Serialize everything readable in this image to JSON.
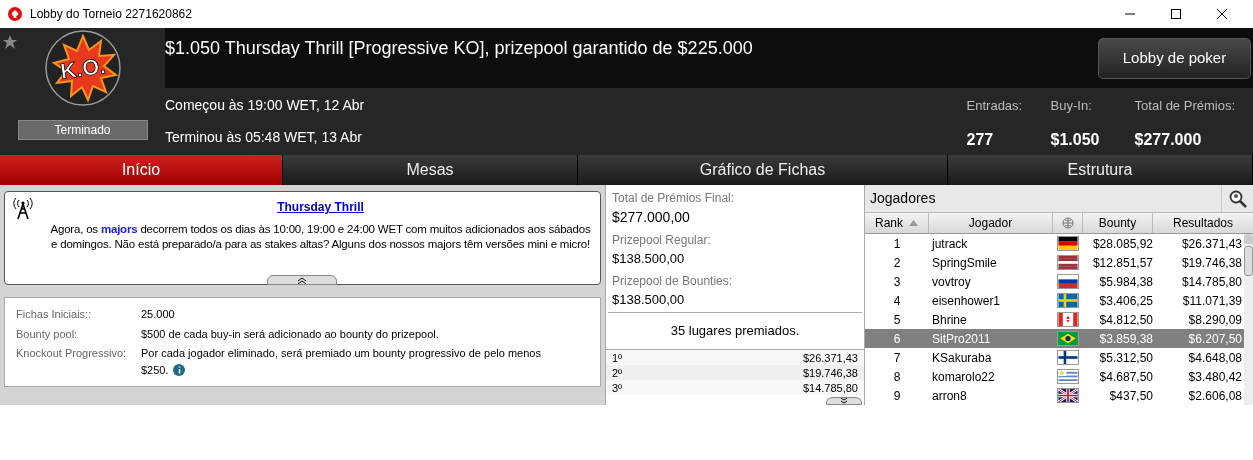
{
  "window": {
    "title": "Lobby do Torneio 2271620862"
  },
  "header": {
    "title": "$1.050 Thursday Thrill [Progressive KO], prizepool garantido de $225.000",
    "logo_text": "K.O.",
    "status": "Terminado",
    "started": "Começou às 19:00 WET, 12 Abr",
    "ended": "Terminou às 05:48 WET, 13 Abr",
    "lobby_button": "Lobby de poker",
    "stats": [
      {
        "label": "Entradas:",
        "value": "277"
      },
      {
        "label": "Buy-In:",
        "value": "$1.050"
      },
      {
        "label": "Total de Prémios:",
        "value": "$277.000"
      }
    ]
  },
  "tabs": [
    {
      "label": "Início",
      "selected": true
    },
    {
      "label": "Mesas",
      "selected": false
    },
    {
      "label": "Gráfico de Fichas",
      "selected": false
    },
    {
      "label": "Estrutura",
      "selected": false
    }
  ],
  "news": {
    "title": "Thursday Thrill",
    "text": "Agora, os **majors** decorrem todos os dias às 10:00, 19:00 e 24:00 WET com muitos adicionados aos sábados e domingos. Não está preparado/a para as stakes altas? Alguns dos nossos majors têm versões mini e micro!"
  },
  "details": [
    {
      "label": "Fichas Iniciais::",
      "value": "25.000"
    },
    {
      "label": "Bounty pool:",
      "value": "$500 de cada buy-in será adicionado ao bounty do prizepool."
    },
    {
      "label": "Knockout Progressivo:",
      "value": "Por cada jogador eliminado, será premiado um bounty progressivo de pelo menos $250."
    }
  ],
  "prizepool": [
    {
      "label": "Total de Prémios Final:",
      "value": "$277.000,00"
    },
    {
      "label": "Prizepool Regular:",
      "value": "$138.500,00"
    },
    {
      "label": "Prizepool de Bounties:",
      "value": "$138.500,00"
    }
  ],
  "paid_places": "35 lugares premiados.",
  "payouts": [
    {
      "place": "1º",
      "amount": "$26.371,43"
    },
    {
      "place": "2º",
      "amount": "$19.746,38"
    },
    {
      "place": "3º",
      "amount": "$14.785,80"
    }
  ],
  "players": {
    "title": "Jogadores",
    "columns": [
      "Rank",
      "Jogador",
      "Bounty",
      "Resultados"
    ],
    "rows": [
      {
        "rank": "1",
        "name": "jutrack",
        "bounty": "$28.085,92",
        "result": "$26.371,43",
        "selected": false
      },
      {
        "rank": "2",
        "name": "SpringSmile",
        "bounty": "$12.851,57",
        "result": "$19.746,38",
        "selected": false
      },
      {
        "rank": "3",
        "name": "vovtroy",
        "bounty": "$5.984,38",
        "result": "$14.785,80",
        "selected": false
      },
      {
        "rank": "4",
        "name": "eisenhower1",
        "bounty": "$3.406,25",
        "result": "$11.071,39",
        "selected": false
      },
      {
        "rank": "5",
        "name": "Bhrine",
        "bounty": "$4.812,50",
        "result": "$8.290,09",
        "selected": false
      },
      {
        "rank": "6",
        "name": "SitPro2011",
        "bounty": "$3.859,38",
        "result": "$6.207,50",
        "selected": true
      },
      {
        "rank": "7",
        "name": "KSakuraba",
        "bounty": "$5.312,50",
        "result": "$4.648,08",
        "selected": false
      },
      {
        "rank": "8",
        "name": "komarolo22",
        "bounty": "$4.687,50",
        "result": "$3.480,42",
        "selected": false
      },
      {
        "rank": "9",
        "name": "arron8",
        "bounty": "$437,50",
        "result": "$2.606,08",
        "selected": false
      }
    ]
  }
}
